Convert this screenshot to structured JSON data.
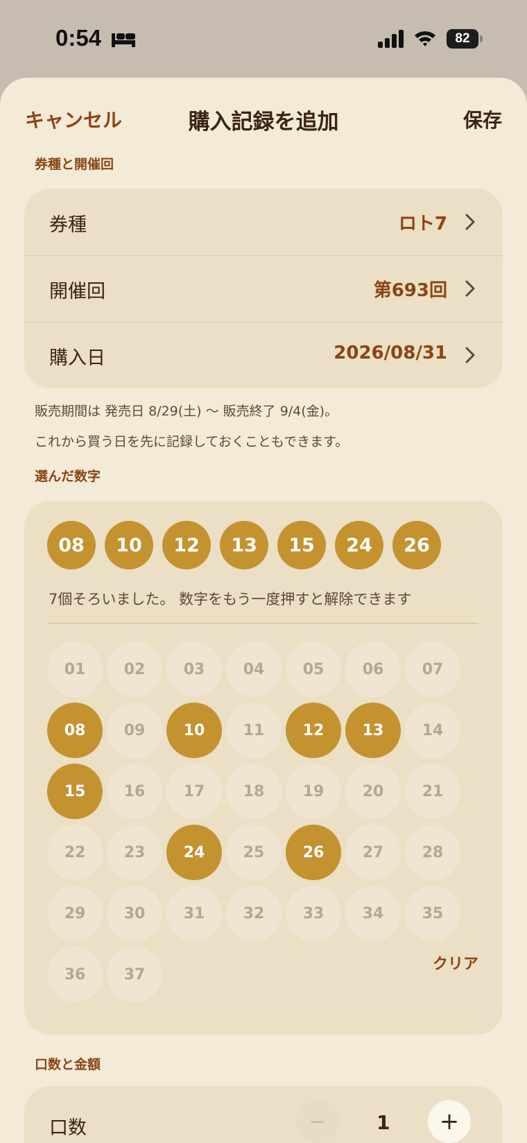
{
  "status_bar": {
    "time": "0:54",
    "battery": "82"
  },
  "nav": {
    "cancel_label": "キャンセル",
    "title": "購入記録を追加",
    "save_label": "保存"
  },
  "ticket_section": {
    "label": "券種と開催回",
    "rows": [
      {
        "label": "券種",
        "value": "ロト7"
      },
      {
        "label": "開催回",
        "value": "第693回"
      },
      {
        "label": "購入日",
        "value": "2026/08/31"
      }
    ],
    "note_lines": [
      "販売期間は 発売日 8/29(土) 〜 販売終了 9/4(金)。",
      "これから買う日を先に記録しておくこともできます。"
    ]
  },
  "numbers_section": {
    "label": "選んだ数字",
    "selected": [
      "08",
      "10",
      "12",
      "13",
      "15",
      "24",
      "26"
    ],
    "hint": "7個そろいました。 数字をもう一度押すと解除できます",
    "grid": [
      "01",
      "02",
      "03",
      "04",
      "05",
      "06",
      "07",
      "08",
      "09",
      "10",
      "11",
      "12",
      "13",
      "14",
      "15",
      "16",
      "17",
      "18",
      "19",
      "20",
      "21",
      "22",
      "23",
      "24",
      "25",
      "26",
      "27",
      "28",
      "29",
      "30",
      "31",
      "32",
      "33",
      "34",
      "35",
      "36",
      "37"
    ],
    "clear_label": "クリア"
  },
  "amount_section": {
    "label": "口数と金額",
    "count_label": "口数",
    "count_value": "1",
    "minus_label": "−",
    "plus_label": "+"
  },
  "colors": {
    "accent": "#c4922f",
    "brand_text": "#8b4513",
    "sheet_bg": "#f4ead8",
    "card_bg": "#ebdfc5"
  }
}
